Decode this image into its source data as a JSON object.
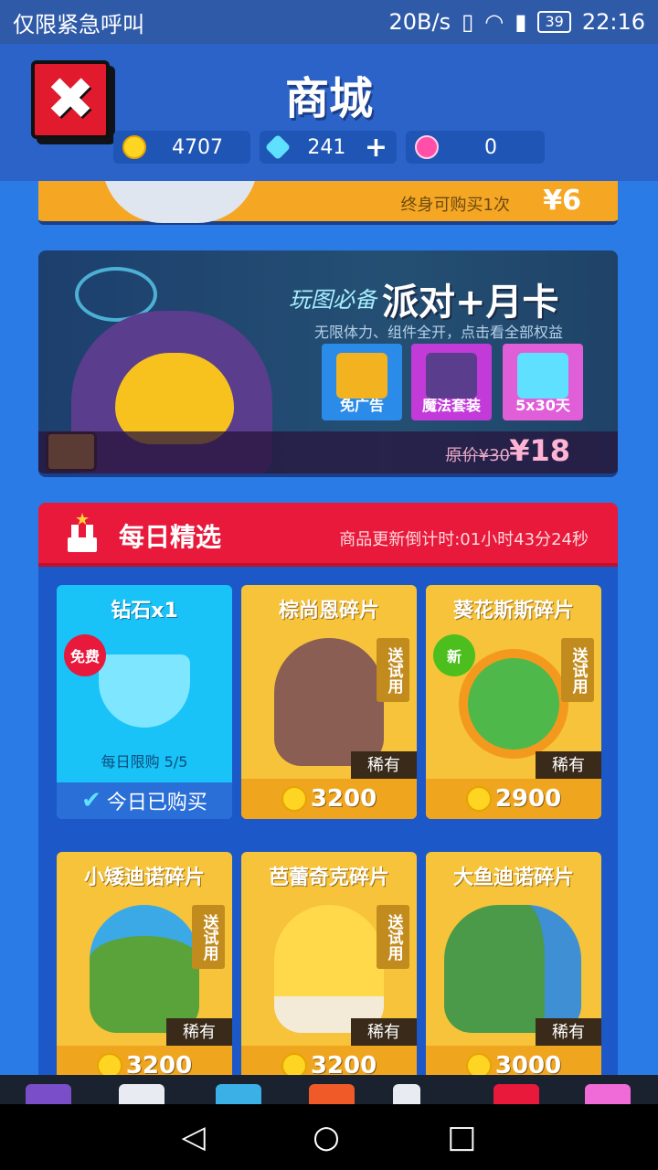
{
  "statusbar": {
    "carrier": "仅限紧急呼叫",
    "speed": "20B/s",
    "battery": "39",
    "time": "22:16"
  },
  "header": {
    "title": "商城",
    "close_label": "✖",
    "gold": "4707",
    "diamonds": "241",
    "diamond_plus": "+",
    "tokens": "0"
  },
  "lifetime_offer": {
    "note": "终身可购买1次",
    "price": "¥6"
  },
  "party_card": {
    "script_title": "玩图必备",
    "headline": "派对+月卡",
    "subtitle": "无限体力、组件全开，点击看全部权益",
    "perks": [
      "免广告",
      "魔法套装",
      "5x30天"
    ],
    "original_price": "原价¥30",
    "price": "¥18"
  },
  "daily": {
    "title": "每日精选",
    "countdown": "商品更新倒计时:01小时43分24秒",
    "items": [
      {
        "name": "钻石x1",
        "badge": "免费",
        "limit": "每日限购 5/5",
        "status": "今日已购买"
      },
      {
        "name": "棕尚恩碎片",
        "trial": "送试用",
        "rarity": "稀有",
        "price": "3200"
      },
      {
        "name": "葵花斯斯碎片",
        "badge": "新",
        "trial": "送试用",
        "rarity": "稀有",
        "price": "2900"
      },
      {
        "name": "小矮迪诺碎片",
        "trial": "送试用",
        "rarity": "稀有",
        "price": "3200"
      },
      {
        "name": "芭蕾奇克碎片",
        "trial": "送试用",
        "rarity": "稀有",
        "price": "3200"
      },
      {
        "name": "大鱼迪诺碎片",
        "rarity": "稀有",
        "price": "3000"
      }
    ]
  },
  "colors": {
    "accent_red": "#e8193b",
    "coin_gold": "#ffd524",
    "card_gold": "#f6c33a",
    "card_blue": "#19c2f7"
  },
  "navbar": {
    "back": "◁",
    "home": "○",
    "recent": "□"
  }
}
